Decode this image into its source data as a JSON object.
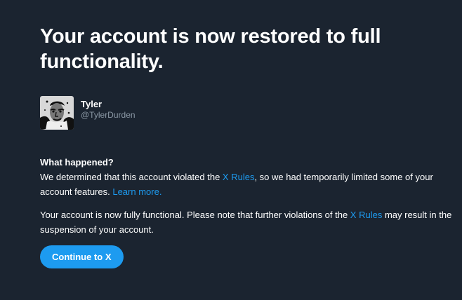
{
  "page": {
    "title": "Your account is now restored to full functionality."
  },
  "profile": {
    "display_name": "Tyler",
    "handle": "@TylerDurden",
    "avatar_icon": "user-avatar"
  },
  "what_happened": {
    "heading": "What happened?",
    "text_1": "We determined that this account violated the ",
    "rules_link": "X Rules",
    "text_2": ", so we had temporarily limited some of your account features. ",
    "learn_more_link": "Learn more."
  },
  "functional_notice": {
    "text_1": "Your account is now fully functional. Please note that further violations of the ",
    "rules_link": "X Rules",
    "text_2": " may result in the suspension of your account."
  },
  "actions": {
    "continue_label": "Continue to X"
  },
  "colors": {
    "background": "#1b2430",
    "accent": "#1d9bf0",
    "text": "#ffffff",
    "muted": "#8b98a5"
  }
}
